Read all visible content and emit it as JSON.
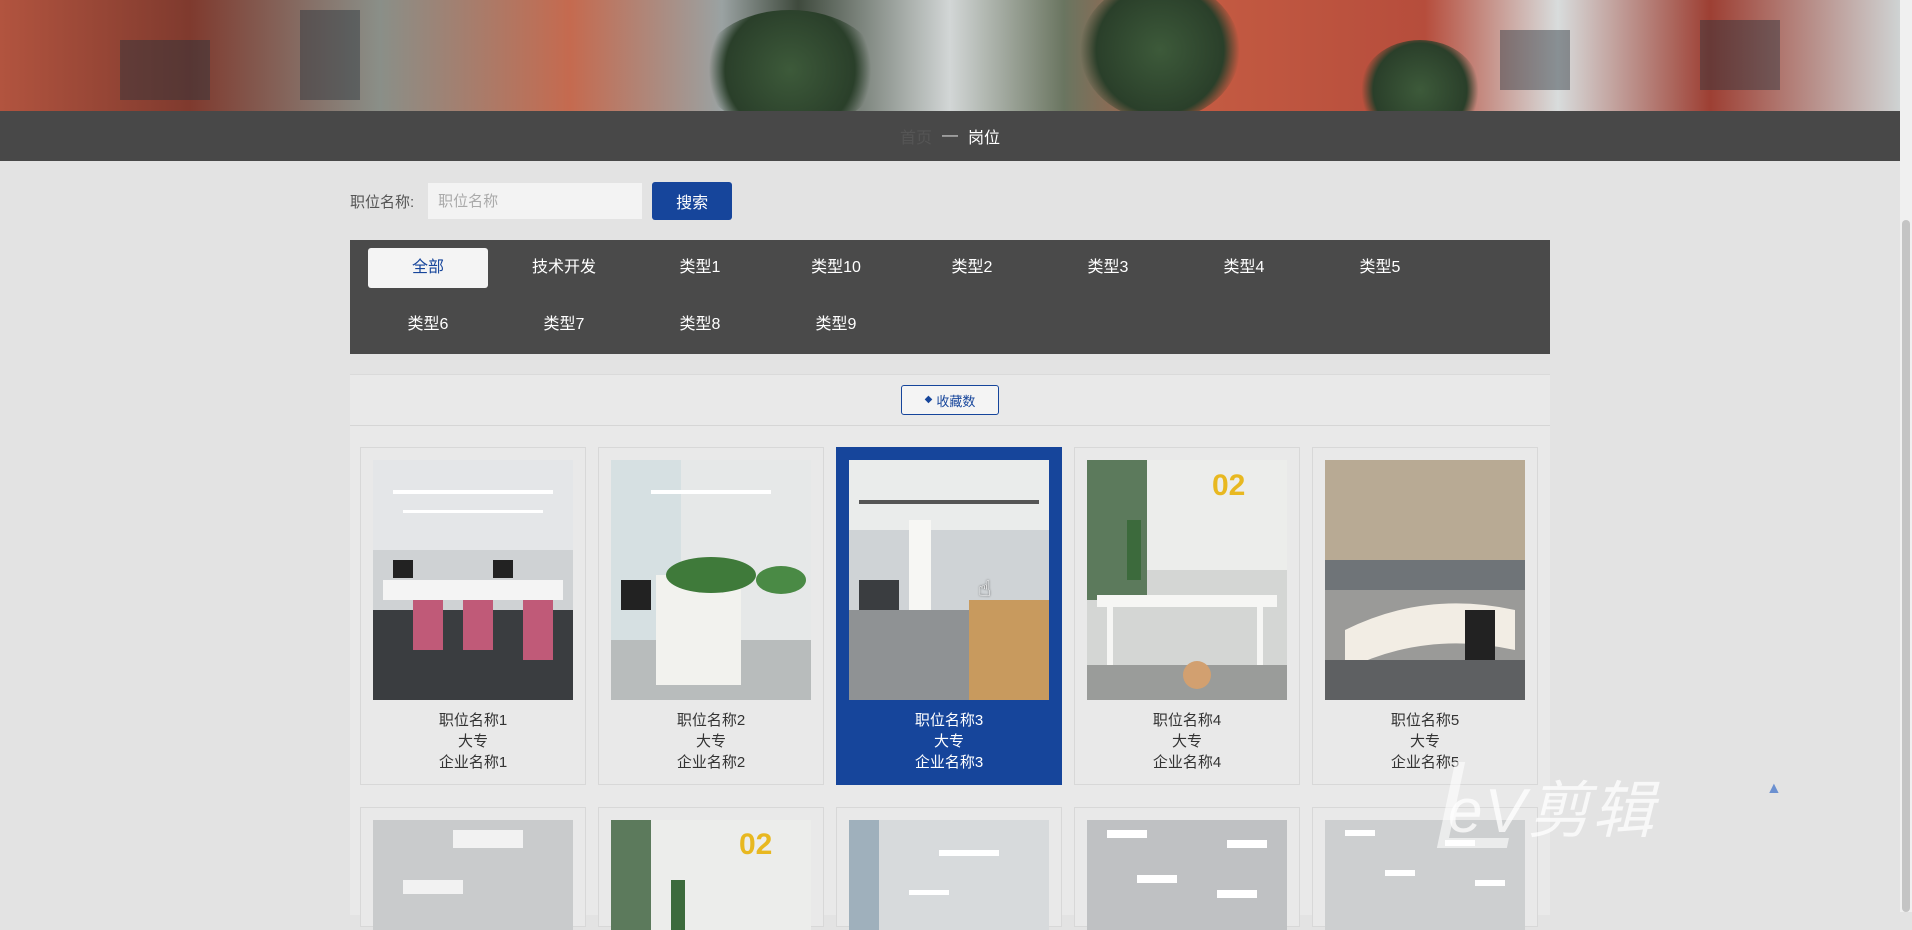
{
  "breadcrumb": {
    "home": "首页",
    "separator": "—",
    "current": "岗位"
  },
  "search": {
    "label": "职位名称:",
    "placeholder": "职位名称",
    "button": "搜索"
  },
  "categories": [
    "全部",
    "技术开发",
    "类型1",
    "类型10",
    "类型2",
    "类型3",
    "类型4",
    "类型5",
    "类型6",
    "类型7",
    "类型8",
    "类型9"
  ],
  "active_category": "全部",
  "sort": {
    "label": "收藏数",
    "icon": "sort-icon"
  },
  "jobs": [
    {
      "name": "职位名称1",
      "education": "大专",
      "company": "企业名称1"
    },
    {
      "name": "职位名称2",
      "education": "大专",
      "company": "企业名称2"
    },
    {
      "name": "职位名称3",
      "education": "大专",
      "company": "企业名称3"
    },
    {
      "name": "职位名称4",
      "education": "大专",
      "company": "企业名称4"
    },
    {
      "name": "职位名称5",
      "education": "大专",
      "company": "企业名称5"
    }
  ],
  "thumb_texts": {
    "job4": "02",
    "row2_2": "02"
  },
  "watermark": "eV剪辑",
  "colors": {
    "primary": "#16459b",
    "dark_bar": "#484848",
    "background": "#e3e3e3"
  }
}
